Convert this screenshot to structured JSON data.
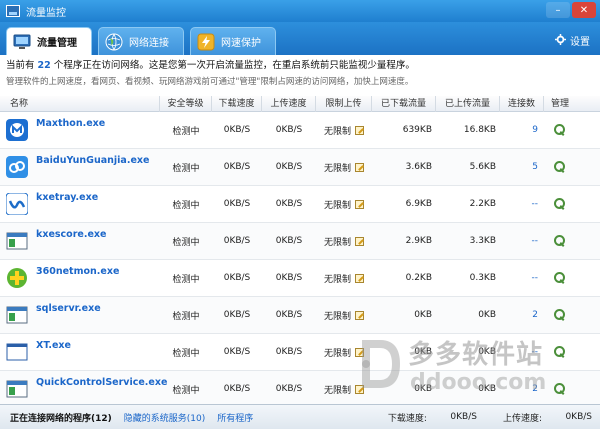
{
  "window": {
    "title": "流量监控"
  },
  "tabs": [
    {
      "label": "流量管理",
      "icon": "monitor-icon",
      "active": true
    },
    {
      "label": "网络连接",
      "icon": "globe-icon",
      "active": false
    },
    {
      "label": "网速保护",
      "icon": "lightning-icon",
      "active": false
    }
  ],
  "settings_label": "设置",
  "info": {
    "line1_prefix": "当前有",
    "process_count": "22",
    "line1_suffix": "个程序正在访问网络。这是您第一次开启流量监控，在重启系统前只能监视少量程序。",
    "line2": "管理软件的上网速度，看网页、看视频、玩网络游戏前可通过\"管理\"限制占网速的访问网络，加快上网速度。"
  },
  "columns": [
    "名称",
    "安全等级",
    "下载速度",
    "上传速度",
    "限制上传",
    "已下载流量",
    "已上传流量",
    "连接数",
    "管理"
  ],
  "rows": [
    {
      "name": "Maxthon.exe",
      "icon": "maxthon-icon",
      "security": "检测中",
      "dl_speed": "0KB/S",
      "ul_speed": "0KB/S",
      "limit": "无限制",
      "downloaded": "639KB",
      "uploaded": "16.8KB",
      "connections": "9"
    },
    {
      "name": "BaiduYunGuanjia.exe",
      "icon": "baidu-cloud-icon",
      "security": "检测中",
      "dl_speed": "0KB/S",
      "ul_speed": "0KB/S",
      "limit": "无限制",
      "downloaded": "3.6KB",
      "uploaded": "5.6KB",
      "connections": "5"
    },
    {
      "name": "kxetray.exe",
      "icon": "kxetray-icon",
      "security": "检测中",
      "dl_speed": "0KB/S",
      "ul_speed": "0KB/S",
      "limit": "无限制",
      "downloaded": "6.9KB",
      "uploaded": "2.2KB",
      "connections": "--"
    },
    {
      "name": "kxescore.exe",
      "icon": "app-window-icon",
      "security": "检测中",
      "dl_speed": "0KB/S",
      "ul_speed": "0KB/S",
      "limit": "无限制",
      "downloaded": "2.9KB",
      "uploaded": "3.3KB",
      "connections": "--"
    },
    {
      "name": "360netmon.exe",
      "icon": "360-icon",
      "security": "检测中",
      "dl_speed": "0KB/S",
      "ul_speed": "0KB/S",
      "limit": "无限制",
      "downloaded": "0.2KB",
      "uploaded": "0.3KB",
      "connections": "--"
    },
    {
      "name": "sqlservr.exe",
      "icon": "app-window-icon",
      "security": "检测中",
      "dl_speed": "0KB/S",
      "ul_speed": "0KB/S",
      "limit": "无限制",
      "downloaded": "0KB",
      "uploaded": "0KB",
      "connections": "2"
    },
    {
      "name": "XT.exe",
      "icon": "blank-window-icon",
      "security": "检测中",
      "dl_speed": "0KB/S",
      "ul_speed": "0KB/S",
      "limit": "无限制",
      "downloaded": "0KB",
      "uploaded": "0KB",
      "connections": "--"
    },
    {
      "name": "QuickControlService.exe",
      "icon": "app-window-icon",
      "security": "检测中",
      "dl_speed": "0KB/S",
      "ul_speed": "0KB/S",
      "limit": "无限制",
      "downloaded": "0KB",
      "uploaded": "0KB",
      "connections": "2"
    }
  ],
  "statusbar": {
    "current": "正在连接网络的程序(12)",
    "hidden": "隐藏的系统服务(10)",
    "all": "所有程序",
    "dl_label": "下载速度:",
    "dl_value": "0KB/S",
    "ul_label": "上传速度:",
    "ul_value": "0KB/S"
  },
  "watermark": {
    "cn": "多多软件站",
    "en": "ddooo.com"
  },
  "colors": {
    "accent": "#1f7fcf",
    "link": "#1b66c9"
  }
}
